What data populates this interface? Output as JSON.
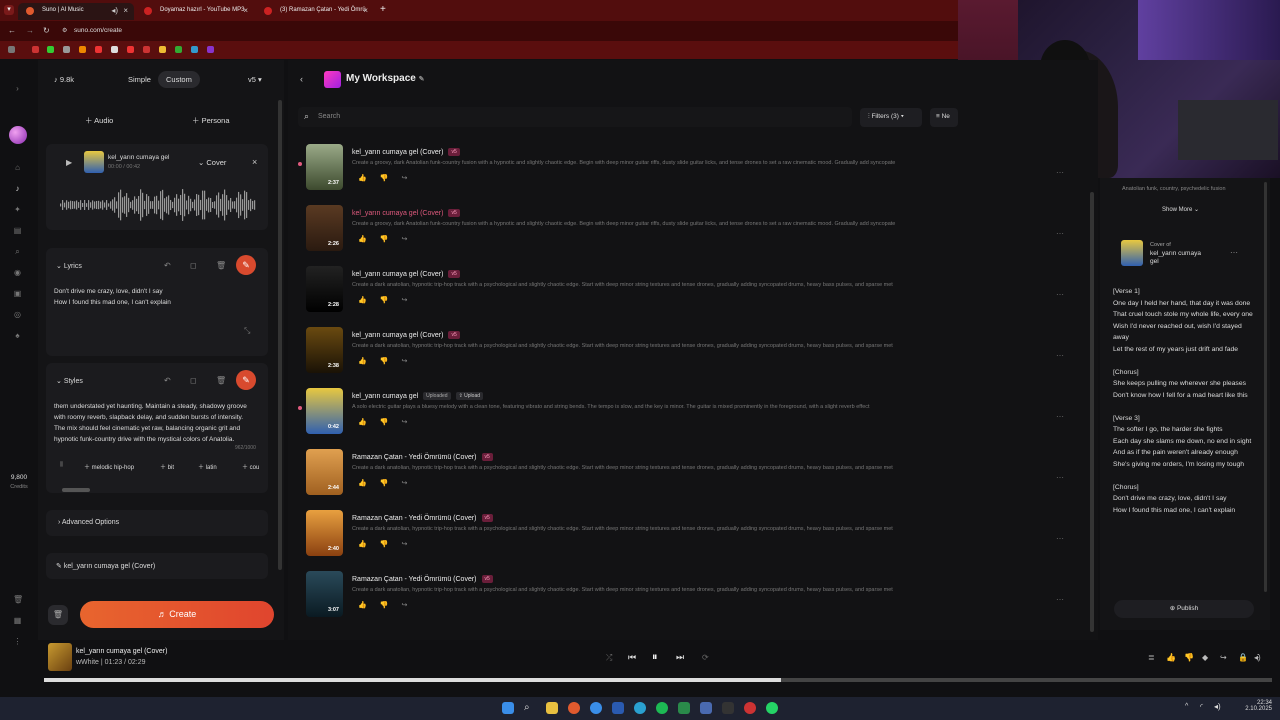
{
  "browser": {
    "tabs": [
      {
        "label": "Suno | AI Music",
        "color": "#e05a2e"
      },
      {
        "label": "Doyamaz hazırl - YouTube MP3",
        "color": "#cc2222"
      },
      {
        "label": "(3) Ramazan Çatan - Yedi Ömrü",
        "color": "#cc2222"
      }
    ],
    "new_tab": "+",
    "url": "suno.com/create"
  },
  "left": {
    "credits_count": "9.8k",
    "mode_simple": "Simple",
    "mode_custom": "Custom",
    "version": "v5",
    "audio_btn": "Audio",
    "persona_btn": "Persona",
    "audio_card": {
      "title": "kel_yarın cumaya gel",
      "time": "00:00 / 00:42",
      "cover_btn": "Cover"
    },
    "lyrics_label": "Lyrics",
    "lyrics_lines": [
      "Don't drive me crazy, love, didn't I say",
      "How I found this mad one, I can't explain"
    ],
    "styles_label": "Styles",
    "styles_text": "them understated yet haunting. Maintain a steady, shadowy groove with roomy reverb, slapback delay, and sudden bursts of intensity. The mix should feel cinematic yet raw, balancing organic grit and hypnotic funk-country drive with the mystical colors of Anatolia.",
    "styles_count": "962/1000",
    "tags": [
      "melodic hip-hop",
      "bit",
      "latin",
      "cou"
    ],
    "advanced": "Advanced Options",
    "title_field": "kel_yarın cumaya gel (Cover)",
    "create_btn": "Create",
    "rail_credits": "9,800",
    "rail_credits_label": "Credits"
  },
  "workspace": {
    "title": "My Workspace",
    "search_placeholder": "Search",
    "filters": "Filters (3)",
    "sort": "Ne"
  },
  "songs": [
    {
      "title": "kel_yarın cumaya gel (Cover)",
      "badge": "v5",
      "desc": "Create a groovy, dark Anatolian funk-country fusion with a hypnotic and slightly chaotic edge. Begin with deep minor guitar riffs, dusty slide guitar licks, and tense drones to set a raw cinematic mood. Gradually add syncopate",
      "dur": "2:37",
      "pink": false,
      "dot": true,
      "c1": "#9aaa88",
      "c2": "#3d4a2e"
    },
    {
      "title": "kel_yarın cumaya gel (Cover)",
      "badge": "v5",
      "desc": "Create a groovy, dark Anatolian funk-country fusion with a hypnotic and slightly chaotic edge. Begin with deep minor guitar riffs, dusty slide guitar licks, and tense drones to set a raw cinematic mood. Gradually add syncopate",
      "dur": "2:26",
      "pink": true,
      "dot": false,
      "c1": "#5a3a22",
      "c2": "#2a1a10"
    },
    {
      "title": "kel_yarın cumaya gel (Cover)",
      "badge": "v5",
      "desc": "Create a dark anatolian, hypnotic trip-hop track with a psychological and slightly chaotic edge. Start with deep minor string textures and tense drones, gradually adding syncopated drums, heavy bass pulses, and sparse met",
      "dur": "2:28",
      "pink": false,
      "dot": false,
      "c1": "#222",
      "c2": "#000"
    },
    {
      "title": "kel_yarın cumaya gel (Cover)",
      "badge": "v5",
      "desc": "Create a dark anatolian, hypnotic trip-hop track with a psychological and slightly chaotic edge. Start with deep minor string textures and tense drones, gradually adding syncopated drums, heavy bass pulses, and sparse met",
      "dur": "2:38",
      "pink": false,
      "dot": false,
      "c1": "#6a4a10",
      "c2": "#1a1206"
    },
    {
      "title": "kel_yarın cumaya gel",
      "badge": "Uploaded",
      "badge2": "Upload",
      "desc": "A solo electric guitar plays a bluesy melody with a clean tone, featuring vibrato and string bends. The tempo is slow, and the key is minor. The guitar is mixed prominently in the foreground, with a slight reverb effect",
      "dur": "0:42",
      "pink": false,
      "dot": true,
      "c1": "#e8c840",
      "c2": "#3060b0"
    },
    {
      "title": "Ramazan Çatan - Yedi Ömrümü (Cover)",
      "badge": "v5",
      "desc": "Create a dark anatolian, hypnotic trip-hop track with a psychological and slightly chaotic edge. Start with deep minor string textures and tense drones, gradually adding syncopated drums, heavy bass pulses, and sparse met",
      "dur": "2:44",
      "pink": false,
      "dot": false,
      "c1": "#e0a050",
      "c2": "#a06020"
    },
    {
      "title": "Ramazan Çatan - Yedi Ömrümü (Cover)",
      "badge": "v5",
      "desc": "Create a dark anatolian, hypnotic trip-hop track with a psychological and slightly chaotic edge. Start with deep minor string textures and tense drones, gradually adding syncopated drums, heavy bass pulses, and sparse met",
      "dur": "2:40",
      "pink": false,
      "dot": false,
      "c1": "#e8a040",
      "c2": "#8a4010"
    },
    {
      "title": "Ramazan Çatan - Yedi Ömrümü (Cover)",
      "badge": "v5",
      "desc": "Create a dark anatolian, hypnotic trip-hop track with a psychological and slightly chaotic edge. Start with deep minor string textures and tense drones, gradually adding syncopated drums, heavy bass pulses, and sparse met",
      "dur": "3:07",
      "pink": false,
      "dot": false,
      "c1": "#2a4a5a",
      "c2": "#0a1a22"
    }
  ],
  "details": {
    "tags": "Anatolian funk, country, psychedelic fusion",
    "show_more": "Show More",
    "cover_of": "Cover of",
    "cover_title": "kel_yarın cumaya gel",
    "lyrics": [
      "[Verse 1]",
      "One day I held her hand, that day it was done",
      "That cruel touch stole my whole life, every one",
      "Wish I'd never reached out, wish I'd stayed away",
      "Let the rest of my years just drift and fade",
      "",
      "[Chorus]",
      "She keeps pulling me wherever she pleases",
      "Don't know how I fell for a mad heart like this",
      "",
      "[Verse 3]",
      "The softer I go, the harder she fights",
      "Each day she slams me down, no end in sight",
      "And as if the pain weren't already enough",
      "She's giving me orders, I'm losing my tough",
      "",
      "[Chorus]",
      "Don't drive me crazy, love, didn't I say",
      "How I found this mad one, I can't explain"
    ],
    "publish": "Publish"
  },
  "player": {
    "title": "kel_yarın cumaya gel (Cover)",
    "artist": "wWhite",
    "time": "01:23 / 02:29",
    "progress": 0.6
  },
  "taskbar": {
    "time": "22:34",
    "date": "2.10.2025"
  },
  "colors": {
    "accent": "#e8652e",
    "pink": "#e05a7e",
    "bg": "#101012"
  }
}
